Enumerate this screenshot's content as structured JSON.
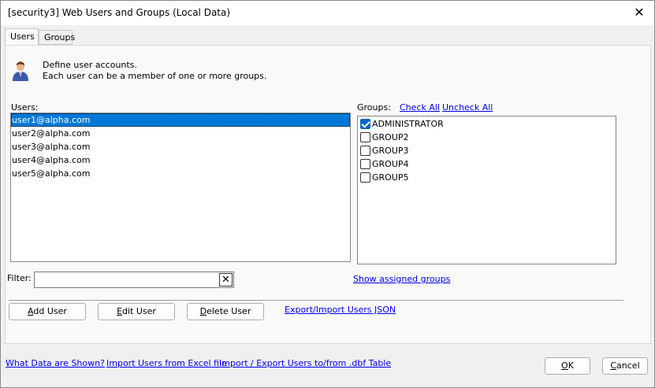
{
  "window": {
    "title": "[security3] Web Users and Groups (Local Data)"
  },
  "tabs": [
    {
      "label": "Users",
      "active": true
    },
    {
      "label": "Groups",
      "active": false
    }
  ],
  "description": {
    "line1": "Define user accounts.",
    "line2": "Each user can be a member of one or more groups."
  },
  "users": {
    "label": "Users:",
    "items": [
      "user1@alpha.com",
      "user2@alpha.com",
      "user3@alpha.com",
      "user4@alpha.com",
      "user5@alpha.com"
    ],
    "selected_index": 0
  },
  "groups": {
    "label": "Groups:",
    "check_all": "Check All",
    "uncheck_all": "Uncheck All",
    "items": [
      {
        "name": "ADMINISTRATOR",
        "checked": true
      },
      {
        "name": "GROUP2",
        "checked": false
      },
      {
        "name": "GROUP3",
        "checked": false
      },
      {
        "name": "GROUP4",
        "checked": false
      },
      {
        "name": "GROUP5",
        "checked": false
      }
    ],
    "show_assigned": "Show assigned groups"
  },
  "filter": {
    "label": "Filter:",
    "value": "",
    "clear_glyph": "✕"
  },
  "buttons": {
    "add_user": {
      "accel": "A",
      "rest": "dd User"
    },
    "edit_user": {
      "accel": "E",
      "rest": "dit User"
    },
    "delete_user": {
      "accel": "D",
      "rest": "elete User"
    },
    "ok": {
      "accel": "O",
      "rest": "K"
    },
    "cancel": {
      "accel": "C",
      "rest": "ancel"
    }
  },
  "links": {
    "export_import_json": "Export/Import Users JSON",
    "what_data": "What Data are Shown?",
    "import_excel": "Import Users from Excel file",
    "import_export_dbf": "Import / Export Users to/from .dbf Table"
  },
  "colors": {
    "selection": "#0078d7",
    "link": "#0000ee",
    "checkbox_checked": "#0067c0"
  },
  "icons": {
    "user": "user-icon",
    "close": "close-icon",
    "check": "checkmark-icon"
  }
}
